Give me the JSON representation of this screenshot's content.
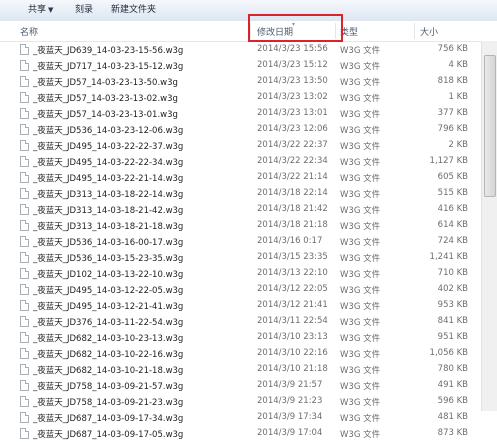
{
  "toolbar": {
    "share_label": "共享",
    "burn_label": "刻录",
    "new_folder_label": "新建文件夹"
  },
  "columns": {
    "name": "名称",
    "date": "修改日期",
    "type": "类型",
    "size": "大小"
  },
  "files": [
    {
      "name": "_夜蓝天_JD639_14-03-23-15-56.w3g",
      "date": "2014/3/23 15:56",
      "type": "W3G 文件",
      "size": "756 KB"
    },
    {
      "name": "_夜蓝天_JD717_14-03-23-15-12.w3g",
      "date": "2014/3/23 15:12",
      "type": "W3G 文件",
      "size": "4 KB"
    },
    {
      "name": "_夜蓝天_JD57_14-03-23-13-50.w3g",
      "date": "2014/3/23 13:50",
      "type": "W3G 文件",
      "size": "818 KB"
    },
    {
      "name": "_夜蓝天_JD57_14-03-23-13-02.w3g",
      "date": "2014/3/23 13:02",
      "type": "W3G 文件",
      "size": "1 KB"
    },
    {
      "name": "_夜蓝天_JD57_14-03-23-13-01.w3g",
      "date": "2014/3/23 13:01",
      "type": "W3G 文件",
      "size": "377 KB"
    },
    {
      "name": "_夜蓝天_JD536_14-03-23-12-06.w3g",
      "date": "2014/3/23 12:06",
      "type": "W3G 文件",
      "size": "796 KB"
    },
    {
      "name": "_夜蓝天_JD495_14-03-22-22-37.w3g",
      "date": "2014/3/22 22:37",
      "type": "W3G 文件",
      "size": "2 KB"
    },
    {
      "name": "_夜蓝天_JD495_14-03-22-22-34.w3g",
      "date": "2014/3/22 22:34",
      "type": "W3G 文件",
      "size": "1,127 KB"
    },
    {
      "name": "_夜蓝天_JD495_14-03-22-21-14.w3g",
      "date": "2014/3/22 21:14",
      "type": "W3G 文件",
      "size": "605 KB"
    },
    {
      "name": "_夜蓝天_JD313_14-03-18-22-14.w3g",
      "date": "2014/3/18 22:14",
      "type": "W3G 文件",
      "size": "515 KB"
    },
    {
      "name": "_夜蓝天_JD313_14-03-18-21-42.w3g",
      "date": "2014/3/18 21:42",
      "type": "W3G 文件",
      "size": "416 KB"
    },
    {
      "name": "_夜蓝天_JD313_14-03-18-21-18.w3g",
      "date": "2014/3/18 21:18",
      "type": "W3G 文件",
      "size": "614 KB"
    },
    {
      "name": "_夜蓝天_JD536_14-03-16-00-17.w3g",
      "date": "2014/3/16 0:17",
      "type": "W3G 文件",
      "size": "724 KB"
    },
    {
      "name": "_夜蓝天_JD536_14-03-15-23-35.w3g",
      "date": "2014/3/15 23:35",
      "type": "W3G 文件",
      "size": "1,241 KB"
    },
    {
      "name": "_夜蓝天_JD102_14-03-13-22-10.w3g",
      "date": "2014/3/13 22:10",
      "type": "W3G 文件",
      "size": "710 KB"
    },
    {
      "name": "_夜蓝天_JD495_14-03-12-22-05.w3g",
      "date": "2014/3/12 22:05",
      "type": "W3G 文件",
      "size": "402 KB"
    },
    {
      "name": "_夜蓝天_JD495_14-03-12-21-41.w3g",
      "date": "2014/3/12 21:41",
      "type": "W3G 文件",
      "size": "953 KB"
    },
    {
      "name": "_夜蓝天_JD376_14-03-11-22-54.w3g",
      "date": "2014/3/11 22:54",
      "type": "W3G 文件",
      "size": "841 KB"
    },
    {
      "name": "_夜蓝天_JD682_14-03-10-23-13.w3g",
      "date": "2014/3/10 23:13",
      "type": "W3G 文件",
      "size": "951 KB"
    },
    {
      "name": "_夜蓝天_JD682_14-03-10-22-16.w3g",
      "date": "2014/3/10 22:16",
      "type": "W3G 文件",
      "size": "1,056 KB"
    },
    {
      "name": "_夜蓝天_JD682_14-03-10-21-18.w3g",
      "date": "2014/3/10 21:18",
      "type": "W3G 文件",
      "size": "780 KB"
    },
    {
      "name": "_夜蓝天_JD758_14-03-09-21-57.w3g",
      "date": "2014/3/9 21:57",
      "type": "W3G 文件",
      "size": "491 KB"
    },
    {
      "name": "_夜蓝天_JD758_14-03-09-21-23.w3g",
      "date": "2014/3/9 21:23",
      "type": "W3G 文件",
      "size": "596 KB"
    },
    {
      "name": "_夜蓝天_JD687_14-03-09-17-34.w3g",
      "date": "2014/3/9 17:34",
      "type": "W3G 文件",
      "size": "481 KB"
    },
    {
      "name": "_夜蓝天_JD687_14-03-09-17-05.w3g",
      "date": "2014/3/9 17:04",
      "type": "W3G 文件",
      "size": "873 KB"
    }
  ],
  "colors": {
    "highlight_box": "#d9232d",
    "toolbar_top": "#f5f8fc",
    "toolbar_bottom": "#dde6f1"
  }
}
